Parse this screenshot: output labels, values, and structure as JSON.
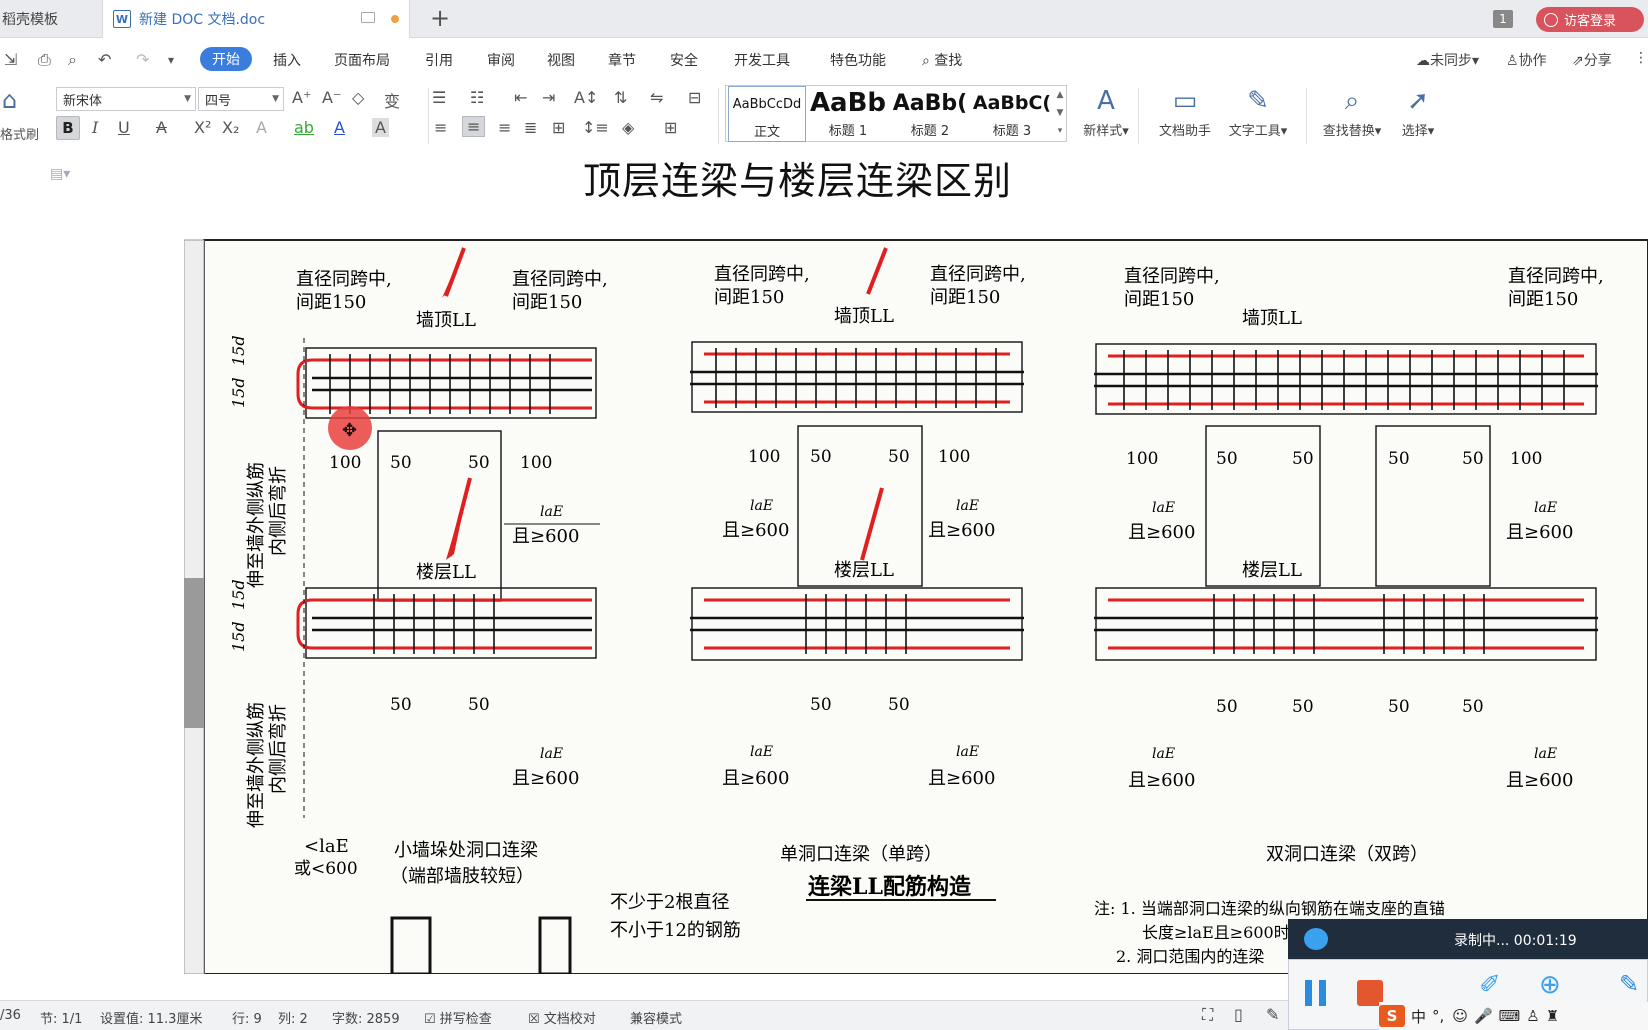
{
  "tabs": {
    "templates": "稻壳模板",
    "doc_tab": "新建 DOC 文档.doc",
    "doc_icon": "W",
    "window_count": "1",
    "login": "访客登录"
  },
  "menu": {
    "items": [
      "开始",
      "插入",
      "页面布局",
      "引用",
      "审阅",
      "视图",
      "章节",
      "安全",
      "开发工具",
      "特色功能"
    ],
    "search": "查找",
    "sync": "未同步",
    "collab": "协作",
    "share": "分享"
  },
  "ribbon": {
    "format_painter": "格式刷",
    "font_name": "新宋体",
    "font_size": "四号",
    "styles": [
      {
        "preview": "AaBbCcDd",
        "name": "正文"
      },
      {
        "preview": "AaBb",
        "name": "标题 1"
      },
      {
        "preview": "AaBb(",
        "name": "标题 2"
      },
      {
        "preview": "AaBbC(",
        "name": "标题 3"
      }
    ],
    "new_style": "新样式",
    "doc_assistant": "文档助手",
    "text_tools": "文字工具",
    "find_replace": "查找替换",
    "select": "选择"
  },
  "document": {
    "title": "顶层连梁与楼层连梁区别",
    "figure": {
      "rebar_note": [
        "直径同跨中,",
        "间距150"
      ],
      "top_beam": "墙顶LL",
      "floor_beam": "楼层LL",
      "dim_15d": "15d",
      "dim_100": "100",
      "dim_50": "50",
      "lae": "laE",
      "ge600": "且≥600",
      "bend_note_a": "伸至墙外侧纵筋",
      "bend_note_b": "内侧后弯折",
      "lt_lae": "<laE",
      "or600": "或<600",
      "caption_small": "小墙垛处洞口连梁",
      "caption_small_sub": "（端部墙肢较短）",
      "caption_single": "单洞口连梁（单跨）",
      "caption_double": "双洞口连梁（双跨）",
      "main_caption": "连梁LL配筋构造",
      "min_bars_1": "不少于2根直径",
      "min_bars_2": "不小于12的钢筋",
      "note_1": "注: 1. 当端部洞口连梁的纵向钢筋在端支座的直锚",
      "note_1b": "长度≥laE且≥600时",
      "note_2": "2. 洞口范围内的连梁"
    }
  },
  "statusbar": {
    "page": "/36",
    "section": "节: 1/1",
    "setting": "设置值: 11.3厘米",
    "row": "行: 9",
    "col": "列: 2",
    "words": "字数: 2859",
    "spell": "拼写检查",
    "proof": "文档校对",
    "compat": "兼容模式"
  },
  "recorder": {
    "status": "录制中... 00:01:19"
  },
  "ime": {
    "lang": "中",
    "punct": "°,"
  },
  "colors": {
    "accent": "#3b7ddd",
    "login": "#d9535c",
    "rebar_red": "#e02020",
    "recorder_bg": "#1f2d3d"
  }
}
